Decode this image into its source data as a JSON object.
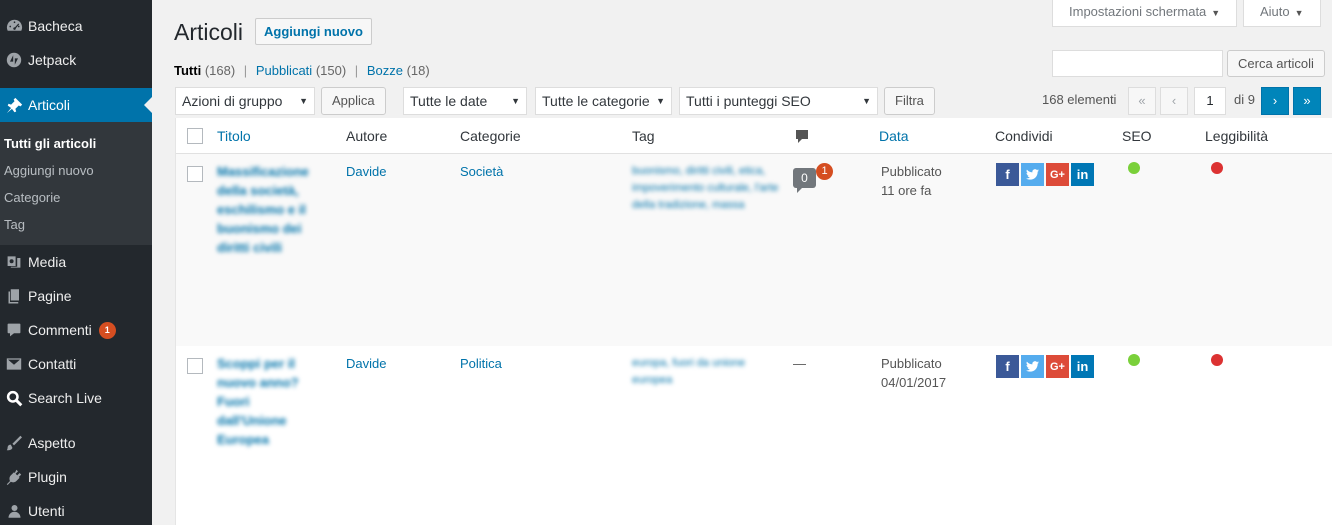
{
  "sidebar": {
    "items": [
      {
        "label": "Bacheca",
        "icon": "dashboard-icon"
      },
      {
        "label": "Jetpack",
        "icon": "jetpack-icon"
      },
      {
        "label": "Articoli",
        "icon": "pin-icon"
      },
      {
        "label": "Media",
        "icon": "media-icon"
      },
      {
        "label": "Pagine",
        "icon": "pages-icon"
      },
      {
        "label": "Commenti",
        "icon": "comments-icon",
        "badge": "1"
      },
      {
        "label": "Contatti",
        "icon": "mail-icon"
      },
      {
        "label": "Search Live",
        "icon": "search-icon"
      },
      {
        "label": "Aspetto",
        "icon": "brush-icon"
      },
      {
        "label": "Plugin",
        "icon": "plugin-icon"
      },
      {
        "label": "Utenti",
        "icon": "users-icon"
      }
    ],
    "submenu": [
      "Tutti gli articoli",
      "Aggiungi nuovo",
      "Categorie",
      "Tag"
    ]
  },
  "header": {
    "title": "Articoli",
    "add_new": "Aggiungi nuovo",
    "screen_options": "Impostazioni schermata",
    "help": "Aiuto"
  },
  "filters": {
    "all": "Tutti",
    "all_count": "(168)",
    "published": "Pubblicati",
    "published_count": "(150)",
    "drafts": "Bozze",
    "drafts_count": "(18)",
    "sep": "|",
    "bulk_action": "Azioni di gruppo",
    "apply": "Applica",
    "dates": "Tutte le date",
    "categories": "Tutte le categorie",
    "seo": "Tutti i punteggi SEO",
    "filter": "Filtra",
    "search_button": "Cerca articoli",
    "search_value": ""
  },
  "pagination": {
    "items": "168 elementi",
    "first": "«",
    "prev": "‹",
    "current": "1",
    "of": "di 9",
    "next": "›",
    "last": "»"
  },
  "table": {
    "columns": {
      "title": "Titolo",
      "author": "Autore",
      "categories": "Categorie",
      "tags": "Tag",
      "date": "Data",
      "share": "Condividi",
      "seo": "SEO",
      "readability": "Leggibilità"
    },
    "rows": [
      {
        "title": [
          "Massificazione",
          "della società,",
          "eschilismo e il",
          "buonismo dei",
          "diritti civili"
        ],
        "author": "Davide",
        "category": "Società",
        "tags": [
          "buonismo, diritti civili, etica,",
          "impoverimento culturale, l'arte",
          "della tradizione, massa"
        ],
        "comments": "0",
        "pending": "1",
        "status": "Pubblicato",
        "date": "11 ore fa",
        "seo_color": "#7ad03a",
        "readability_color": "#dc3232"
      },
      {
        "title": [
          "Scoppi per il",
          "nuovo anno?",
          "Fuori",
          "dall'Unione",
          "Europea"
        ],
        "author": "Davide",
        "category": "Politica",
        "tags": [
          "europa, fuori da unione",
          "europea"
        ],
        "comments": "—",
        "status": "Pubblicato",
        "date": "04/01/2017",
        "seo_color": "#7ad03a",
        "readability_color": "#dc3232"
      }
    ]
  },
  "social": {
    "facebook": {
      "glyph": "f",
      "color": "#3b5998"
    },
    "twitter": {
      "glyph": "t",
      "color": "#55acee"
    },
    "googleplus": {
      "glyph": "G+",
      "color": "#dd4b39"
    },
    "linkedin": {
      "glyph": "in",
      "color": "#0077b5"
    }
  }
}
